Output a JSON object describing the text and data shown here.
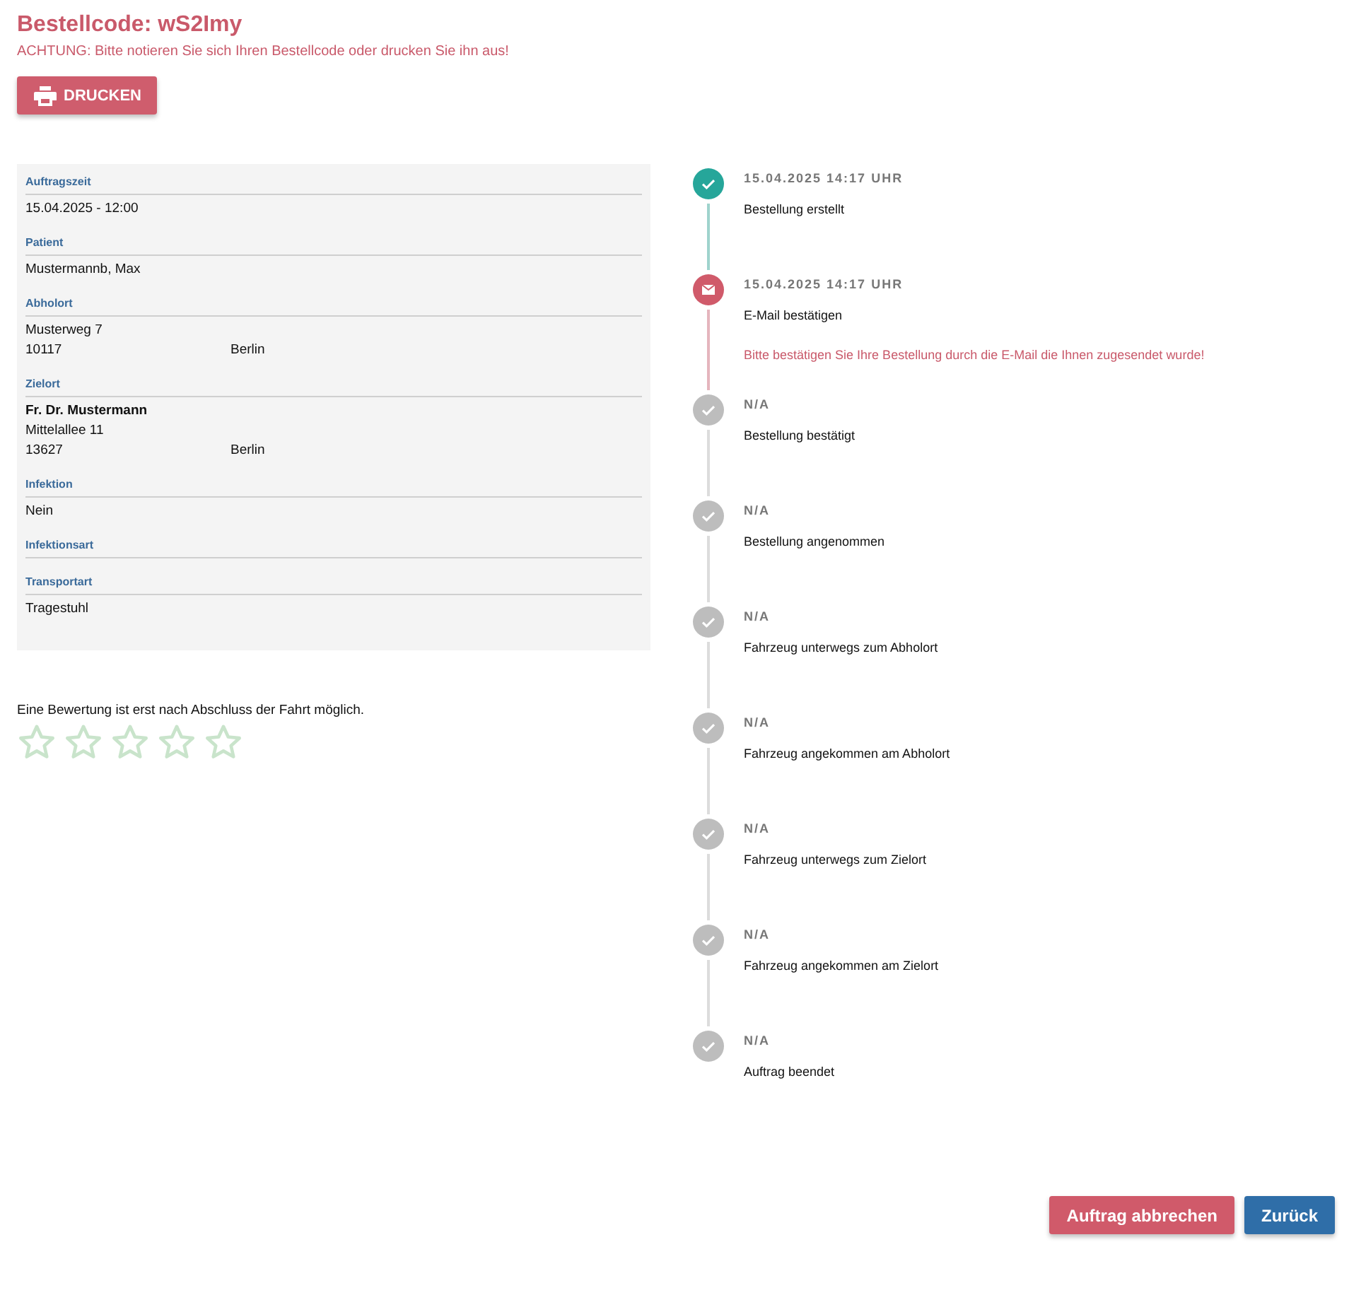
{
  "header": {
    "title": "Bestellcode: wS2Imy",
    "warning": "ACHTUNG: Bitte notieren Sie sich Ihren Bestellcode oder drucken Sie ihn aus!",
    "print_button": "DRUCKEN"
  },
  "details": [
    {
      "label": "Auftragszeit",
      "lines": [
        {
          "cells": [
            "15.04.2025 - 12:00"
          ],
          "bold": false
        }
      ]
    },
    {
      "label": "Patient",
      "lines": [
        {
          "cells": [
            "Mustermannb, Max"
          ],
          "bold": false
        }
      ]
    },
    {
      "label": "Abholort",
      "lines": [
        {
          "cells": [
            "Musterweg 7"
          ],
          "bold": false
        },
        {
          "cells": [
            "10117",
            "Berlin"
          ],
          "bold": false
        }
      ]
    },
    {
      "label": "Zielort",
      "lines": [
        {
          "cells": [
            "Fr. Dr. Mustermann"
          ],
          "bold": true
        },
        {
          "cells": [
            "Mittelallee 11"
          ],
          "bold": false
        },
        {
          "cells": [
            "13627",
            "Berlin"
          ],
          "bold": false
        }
      ]
    },
    {
      "label": "Infektion",
      "lines": [
        {
          "cells": [
            "Nein"
          ],
          "bold": false
        }
      ]
    },
    {
      "label": "Infektionsart"
    },
    {
      "label": "Transportart",
      "lines": [
        {
          "cells": [
            "Tragestuhl"
          ],
          "bold": false
        }
      ]
    }
  ],
  "rating": {
    "note": "Eine Bewertung ist erst nach Abschluss der Fahrt möglich.",
    "stars": 0
  },
  "timeline": [
    {
      "kind": "done",
      "time": "15.04.2025 14:17 UHR",
      "title": "Bestellung erstellt"
    },
    {
      "kind": "email",
      "time": "15.04.2025 14:17 UHR",
      "title": "E-Mail bestätigen",
      "note": "Bitte bestätigen Sie Ihre Bestellung durch die E-Mail die Ihnen zugesendet wurde!"
    },
    {
      "kind": "na",
      "time": "N/A",
      "title": "Bestellung bestätigt"
    },
    {
      "kind": "na",
      "time": "N/A",
      "title": "Bestellung angenommen"
    },
    {
      "kind": "na",
      "time": "N/A",
      "title": "Fahrzeug unterwegs zum Abholort"
    },
    {
      "kind": "na",
      "time": "N/A",
      "title": "Fahrzeug angekommen am Abholort"
    },
    {
      "kind": "na",
      "time": "N/A",
      "title": "Fahrzeug unterwegs zum Zielort"
    },
    {
      "kind": "na",
      "time": "N/A",
      "title": "Fahrzeug angekommen am Zielort"
    },
    {
      "kind": "na",
      "time": "N/A",
      "title": "Auftrag beendet"
    }
  ],
  "actions": [
    {
      "kind": "danger",
      "label": "Auftrag abbrechen"
    },
    {
      "kind": "primary",
      "label": "Zurück"
    }
  ]
}
